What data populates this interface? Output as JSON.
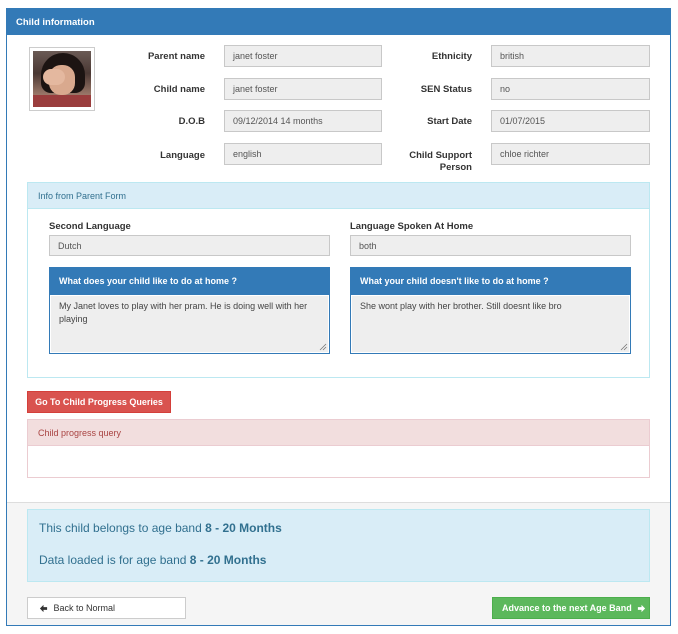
{
  "panel": {
    "title": "Child information"
  },
  "details": {
    "parent_name": {
      "label": "Parent name",
      "value": "janet foster"
    },
    "child_name": {
      "label": "Child name",
      "value": "janet foster"
    },
    "dob": {
      "label": "D.O.B",
      "value": "09/12/2014 14 months"
    },
    "language": {
      "label": "Language",
      "value": "english"
    },
    "ethnicity": {
      "label": "Ethnicity",
      "value": "british"
    },
    "sen_status": {
      "label": "SEN Status",
      "value": "no"
    },
    "start_date": {
      "label": "Start Date",
      "value": "01/07/2015"
    },
    "support_person": {
      "label_line1": "Child Support",
      "label_line2": "Person",
      "value": "chloe richter"
    }
  },
  "parent_form": {
    "title": "Info from Parent Form",
    "second_language": {
      "label": "Second Language",
      "value": "Dutch"
    },
    "home_language": {
      "label": "Language Spoken At Home",
      "value": "both"
    },
    "likes": {
      "title": "What does your child like to do at home ?",
      "text": "My Janet loves to play with her pram. He is doing well with her playing"
    },
    "dislikes": {
      "title": "What your child doesn't like to do at home ?",
      "text": "She wont play with her brother. Still doesnt like bro"
    }
  },
  "progress": {
    "button_label": "Go To Child Progress Queries",
    "query_title": "Child progress query"
  },
  "age_band": {
    "line1_prefix": "This child belongs to age band ",
    "line1_band": "8 - 20 Months",
    "line2_prefix": "Data loaded is for age band ",
    "line2_band": "8 - 20 Months"
  },
  "footer": {
    "back_label": "Back to Normal",
    "advance_label": "Advance to the next Age Band"
  },
  "colors": {
    "primary": "#337ab7",
    "danger": "#d9534f",
    "success": "#5cb85c",
    "info_bg": "#d9edf7",
    "info_text": "#31708f"
  },
  "icons": {
    "back": "arrow-left-icon",
    "advance": "arrow-right-icon"
  }
}
